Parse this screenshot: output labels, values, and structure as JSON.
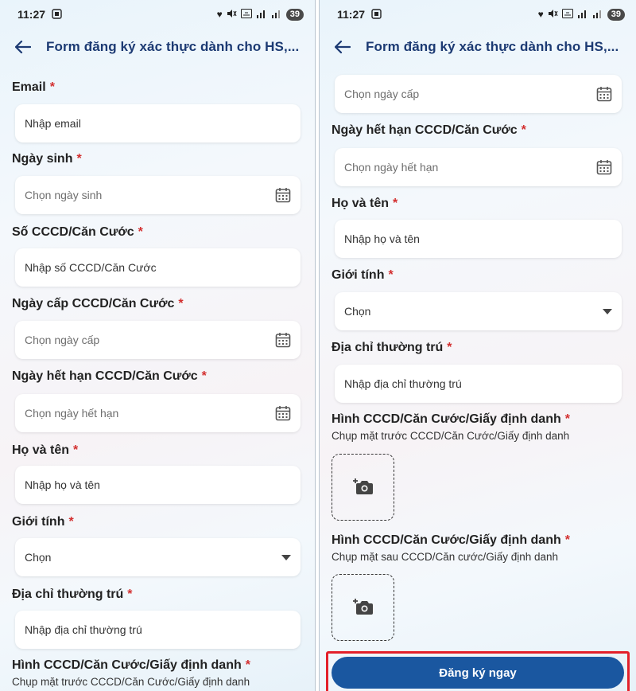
{
  "status": {
    "time": "11:27",
    "battery": "39"
  },
  "appbar": {
    "title": "Form đăng ký xác thực dành cho HS,..."
  },
  "required_mark": "*",
  "form": {
    "email": {
      "label": "Email",
      "placeholder": "Nhập email"
    },
    "dob": {
      "label": "Ngày sinh",
      "placeholder": "Chọn ngày sinh"
    },
    "id_number": {
      "label": "Số CCCD/Căn Cước",
      "placeholder": "Nhập số CCCD/Căn Cước"
    },
    "issue_date": {
      "label": "Ngày cấp CCCD/Căn Cước",
      "placeholder": "Chọn ngày cấp"
    },
    "expiry_date": {
      "label": "Ngày hết hạn CCCD/Căn Cước",
      "placeholder": "Chọn ngày hết hạn"
    },
    "full_name": {
      "label": "Họ và tên",
      "placeholder": "Nhập họ và tên"
    },
    "gender": {
      "label": "Giới tính",
      "value": "Chọn"
    },
    "address": {
      "label": "Địa chỉ thường trú",
      "placeholder": "Nhập địa chỉ thường trú"
    },
    "id_front": {
      "label": "Hình CCCD/Căn Cước/Giấy định danh",
      "hint": "Chụp mặt trước CCCD/Căn Cước/Giấy định danh"
    },
    "id_back": {
      "label": "Hình CCCD/Căn Cước/Giấy định danh",
      "hint": "Chụp mặt sau CCCD/Căn cước/Giấy định danh"
    }
  },
  "submit": {
    "label": "Đăng ký ngay"
  },
  "colors": {
    "title": "#1c3a73",
    "required": "#d32f2f",
    "button": "#1a57a0",
    "highlight": "#e3202a"
  }
}
